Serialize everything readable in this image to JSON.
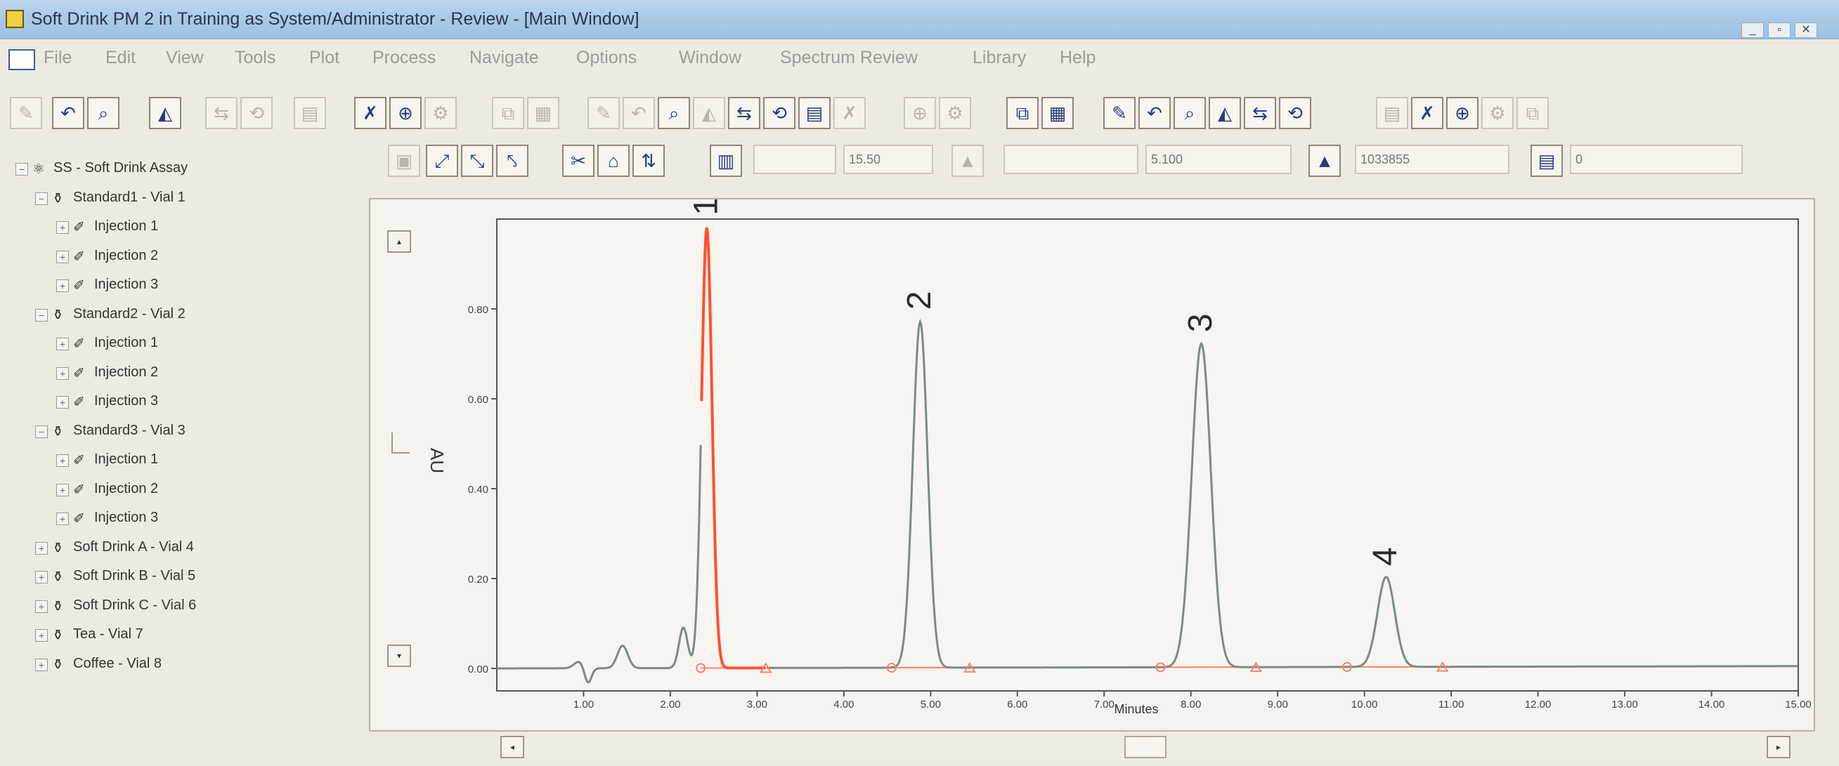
{
  "window": {
    "title": "Soft Drink PM 2 in Training as System/Administrator - Review - [Main Window]"
  },
  "menu": [
    "File",
    "Edit",
    "View",
    "Tools",
    "Plot",
    "Process",
    "Navigate",
    "Options",
    "Window",
    "Spectrum Review",
    "Library",
    "Help"
  ],
  "toolbar2": {
    "field1": "15.50",
    "field2": "5.100",
    "field3": "1033855",
    "field4": "0"
  },
  "tree": [
    {
      "label": "SS - Soft Drink Assay",
      "icon": "assay-icon",
      "level": 0
    },
    {
      "label": "Standard1 - Vial 1",
      "icon": "vial-icon",
      "level": 1
    },
    {
      "label": "Injection 1",
      "icon": "injection-icon",
      "level": 2
    },
    {
      "label": "Injection 2",
      "icon": "injection-icon",
      "level": 2
    },
    {
      "label": "Injection 3",
      "icon": "injection-icon",
      "level": 2
    },
    {
      "label": "Standard2 - Vial 2",
      "icon": "vial-icon",
      "level": 1
    },
    {
      "label": "Injection 1",
      "icon": "injection-icon",
      "level": 2
    },
    {
      "label": "Injection 2",
      "icon": "injection-icon",
      "level": 2
    },
    {
      "label": "Injection 3",
      "icon": "injection-icon",
      "level": 2
    },
    {
      "label": "Standard3 - Vial 3",
      "icon": "vial-icon",
      "level": 1
    },
    {
      "label": "Injection 1",
      "icon": "injection-icon",
      "level": 2
    },
    {
      "label": "Injection 2",
      "icon": "injection-icon",
      "level": 2
    },
    {
      "label": "Injection 3",
      "icon": "injection-icon",
      "level": 2
    },
    {
      "label": "Soft Drink A - Vial 4",
      "icon": "vial-icon",
      "level": 1
    },
    {
      "label": "Soft Drink B - Vial 5",
      "icon": "vial-icon",
      "level": 1
    },
    {
      "label": "Soft Drink C - Vial 6",
      "icon": "vial-icon",
      "level": 1
    },
    {
      "label": "Tea - Vial 7",
      "icon": "vial-icon",
      "level": 1
    },
    {
      "label": "Coffee - Vial 8",
      "icon": "vial-icon",
      "level": 1
    }
  ],
  "chart_data": {
    "type": "line",
    "title": "",
    "xlabel": "Minutes",
    "ylabel": "AU",
    "xlim": [
      0.0,
      15.0
    ],
    "ylim": [
      -0.05,
      1.0
    ],
    "x_ticks": [
      "1.00",
      "2.00",
      "3.00",
      "4.00",
      "5.00",
      "6.00",
      "7.00",
      "8.00",
      "9.00",
      "10.00",
      "11.00",
      "12.00",
      "13.00",
      "14.00",
      "15.00"
    ],
    "y_ticks": [
      "0.00",
      "0.20",
      "0.40",
      "0.60",
      "0.80"
    ],
    "grid": false,
    "colors": {
      "trace": "#7d8a82",
      "highlight": "#ff5030",
      "baseline": "#ff8070"
    },
    "baseline_offset": 0.005,
    "peaks": [
      {
        "label": "1",
        "rt": 2.42,
        "height": 0.98,
        "sigma": 0.06,
        "highlighted": true,
        "start": 2.35,
        "end": 3.1
      },
      {
        "label": "2",
        "rt": 4.88,
        "height": 0.77,
        "sigma": 0.085,
        "highlighted": false,
        "start": 4.55,
        "end": 5.45
      },
      {
        "label": "3",
        "rt": 8.12,
        "height": 0.72,
        "sigma": 0.11,
        "highlighted": false,
        "start": 7.65,
        "end": 8.75
      },
      {
        "label": "4",
        "rt": 10.25,
        "height": 0.2,
        "sigma": 0.1,
        "highlighted": false,
        "start": 9.8,
        "end": 10.9
      }
    ],
    "minor_bumps": [
      {
        "rt": 0.95,
        "height": 0.015,
        "sigma": 0.06
      },
      {
        "rt": 1.05,
        "height": -0.035,
        "sigma": 0.04
      },
      {
        "rt": 1.45,
        "height": 0.05,
        "sigma": 0.06
      },
      {
        "rt": 2.15,
        "height": 0.09,
        "sigma": 0.05
      }
    ]
  }
}
